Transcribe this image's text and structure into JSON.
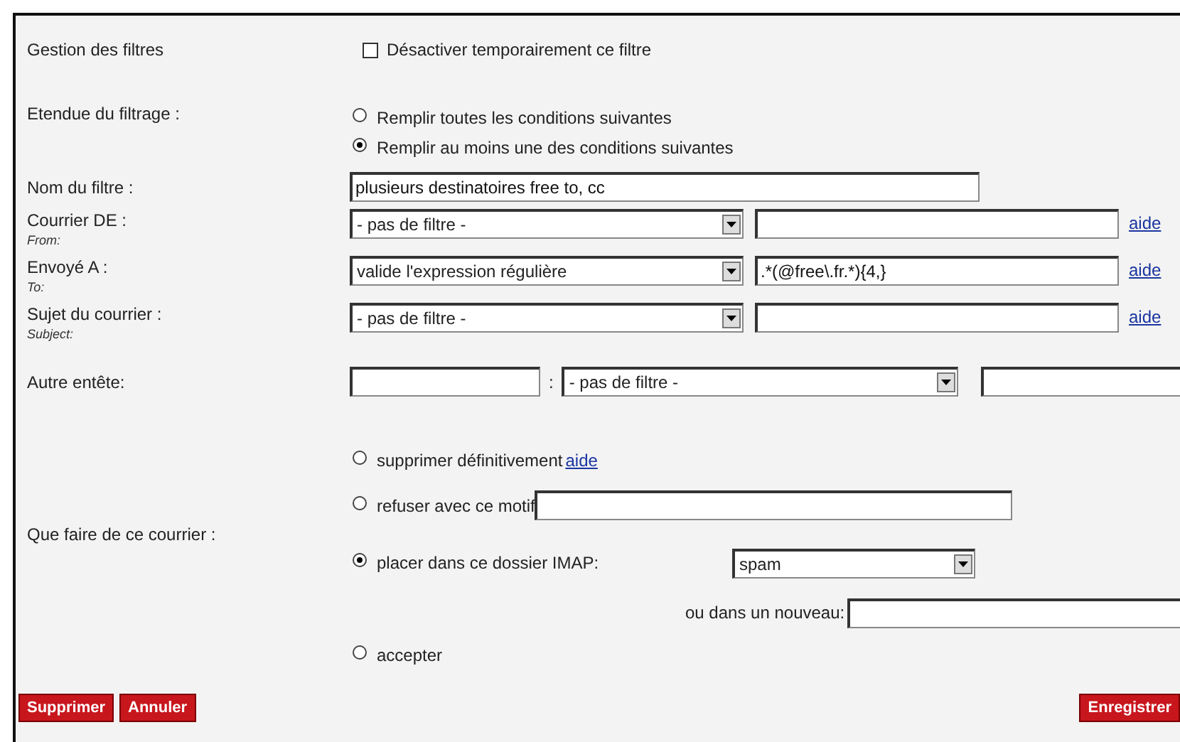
{
  "management": {
    "label": "Gestion des filtres",
    "disable_checkbox": {
      "label": "Désactiver temporairement ce filtre",
      "checked": false
    }
  },
  "scope": {
    "label": "Etendue du filtrage :",
    "options": [
      {
        "label": "Remplir toutes les conditions suivantes",
        "selected": false
      },
      {
        "label": "Remplir au moins une des conditions suivantes",
        "selected": true
      }
    ]
  },
  "name": {
    "label": "Nom du filtre :",
    "value": "plusieurs destinatoires free to, cc"
  },
  "conditions": [
    {
      "label": "Courrier DE :",
      "sublabel": "From:",
      "operator": "- pas de filtre -",
      "help": "aide"
    },
    {
      "label": "Envoyé A :",
      "sublabel": "To:",
      "operator": "valide l'expression régulière",
      "value": ".*(@free\\.fr.*){4,}",
      "help": "aide"
    },
    {
      "label": "Sujet du courrier :",
      "sublabel": "Subject:",
      "operator": "- pas de filtre -",
      "help": "aide"
    }
  ],
  "other_header": {
    "label": "Autre entête:",
    "separator": ":",
    "operator": "- pas de filtre -"
  },
  "action": {
    "label": "Que faire de ce courrier :",
    "options": [
      {
        "kind": "delete",
        "label": "supprimer définitivement",
        "help": "aide",
        "selected": false
      },
      {
        "kind": "refuse",
        "label": "refuser avec ce motif",
        "selected": false
      },
      {
        "kind": "folder",
        "label": "placer dans ce dossier IMAP:",
        "folder": "spam",
        "new_folder_label": "ou dans un nouveau:",
        "selected": true
      },
      {
        "kind": "accept",
        "label": "accepter",
        "selected": false
      }
    ]
  },
  "buttons_left": [
    "Supprimer",
    "Annuler"
  ],
  "buttons_right": [
    "Enregistrer"
  ]
}
